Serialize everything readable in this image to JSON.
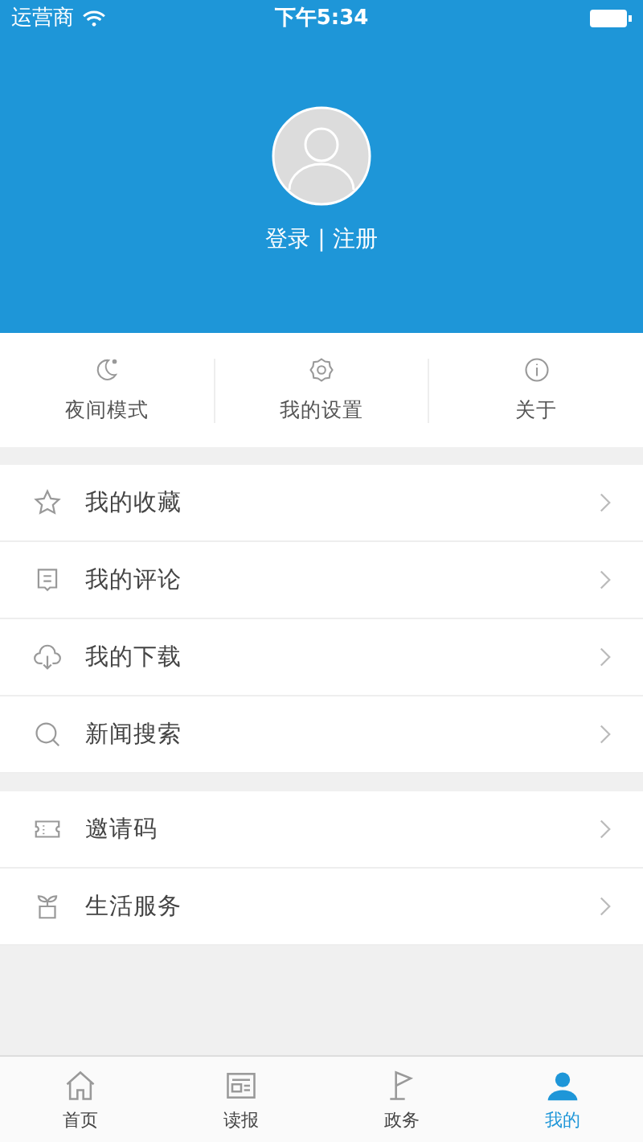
{
  "status_bar": {
    "carrier": "运营商",
    "time": "下午5:34"
  },
  "profile": {
    "login_text": "登录 | 注册"
  },
  "quick_actions": [
    {
      "kind": "moon",
      "label": "夜间模式"
    },
    {
      "kind": "gear",
      "label": "我的设置"
    },
    {
      "kind": "info",
      "label": "关于"
    }
  ],
  "menu_groups": [
    [
      {
        "kind": "star",
        "label": "我的收藏"
      },
      {
        "kind": "comment",
        "label": "我的评论"
      },
      {
        "kind": "download",
        "label": "我的下载"
      },
      {
        "kind": "search",
        "label": "新闻搜索"
      }
    ],
    [
      {
        "kind": "ticket",
        "label": "邀请码"
      },
      {
        "kind": "plant",
        "label": "生活服务"
      }
    ]
  ],
  "tab_bar": [
    {
      "kind": "home",
      "label": "首页",
      "selected": false
    },
    {
      "kind": "newspaper",
      "label": "读报",
      "selected": false
    },
    {
      "kind": "flag",
      "label": "政务",
      "selected": false
    },
    {
      "kind": "person",
      "label": "我的",
      "selected": true
    }
  ]
}
